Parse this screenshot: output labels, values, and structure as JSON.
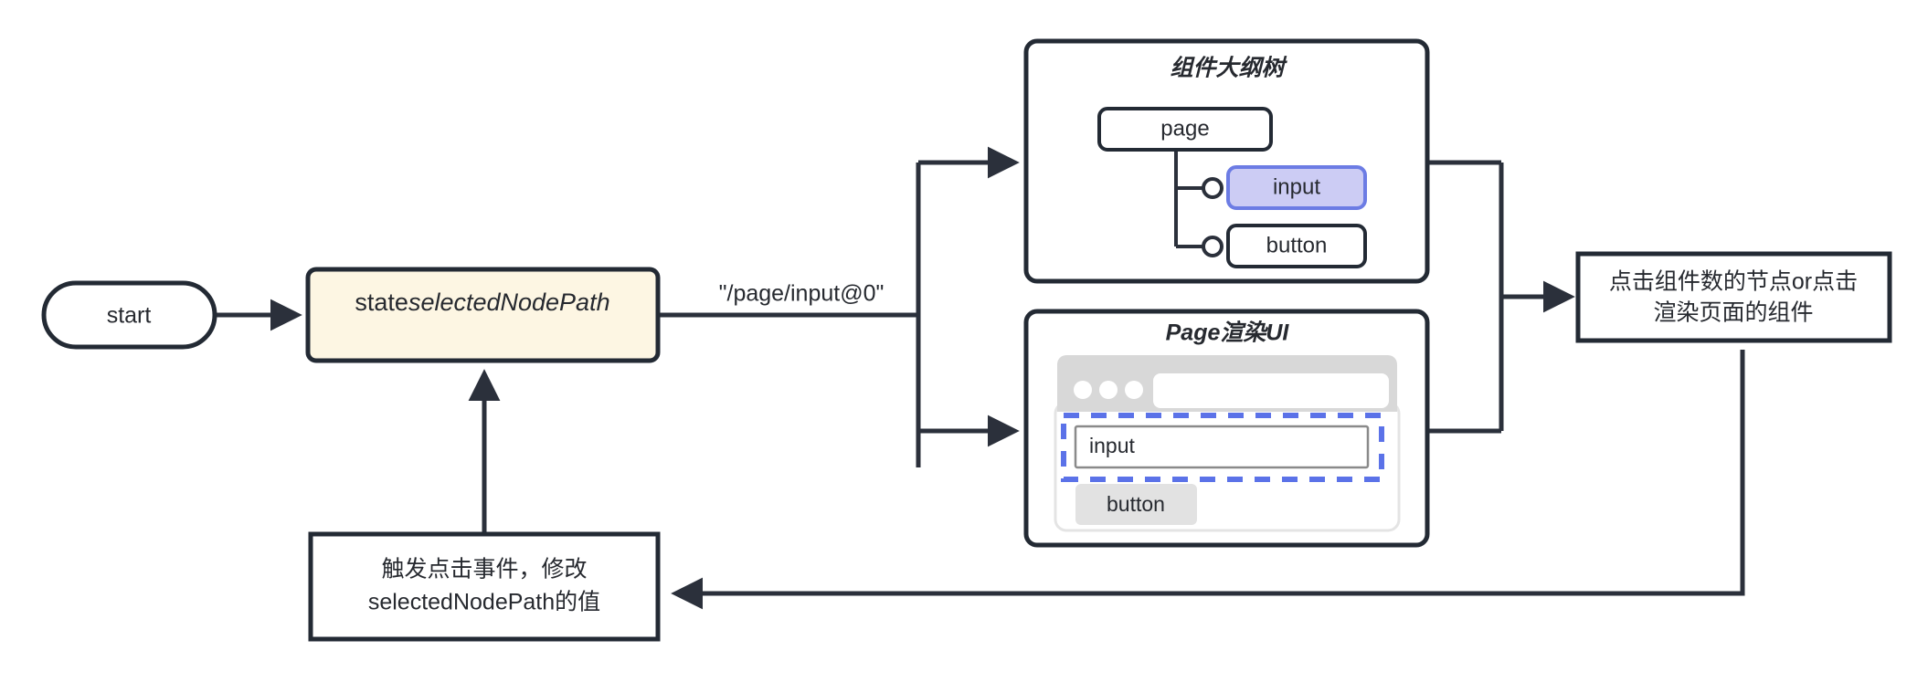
{
  "diagram": {
    "title_hidden": "",
    "nodes": {
      "start": {
        "label": "start",
        "shape": "stadium"
      },
      "state": {
        "label_plain": "state",
        "label_italic": "selectedNodePath",
        "shape": "rounded-rect",
        "fill": "#fdf6e3"
      },
      "click_source": {
        "line1": "点击组件数的节点or点击",
        "line2": "渲染页面的组件",
        "shape": "rect"
      },
      "trigger": {
        "line1": "触发点击事件，修改",
        "line2": "selectedNodePath的值",
        "shape": "rect"
      }
    },
    "edges": {
      "state_to_branch_label": "\"/page/input@0\""
    },
    "panels": {
      "tree": {
        "title": "组件大纲树",
        "nodes": [
          {
            "label": "page",
            "selected": false
          },
          {
            "label": "input",
            "selected": true
          },
          {
            "label": "button",
            "selected": false
          }
        ]
      },
      "page_ui": {
        "title": "Page渲染UI",
        "browser": {
          "dots": 3,
          "url_value": ""
        },
        "elements": [
          {
            "type": "input",
            "label": "input",
            "selected": true
          },
          {
            "type": "button",
            "label": "button",
            "selected": false
          }
        ]
      }
    },
    "colors": {
      "stroke": "#232a34",
      "state_fill": "#fdf6e3",
      "selection_blue": "#5b72e8",
      "tree_selected_fill": "#ccccf4",
      "tree_selected_stroke": "#6c7ce4",
      "chrome_gray": "#d8d8d8",
      "button_gray": "#e2e2e2"
    }
  }
}
